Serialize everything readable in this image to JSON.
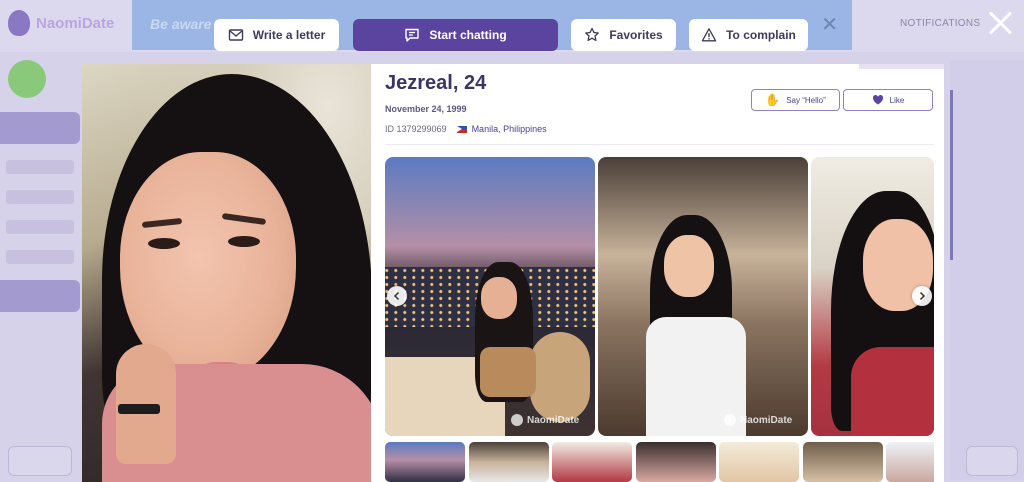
{
  "background": {
    "logo_text": "NaomiDate",
    "banner_text": "Be aware",
    "notifications_label": "NOTIFICATIONS"
  },
  "top_actions": {
    "write_letter": "Write a letter",
    "start_chatting": "Start chatting",
    "favorites": "Favorites",
    "complain": "To complain"
  },
  "profile": {
    "name": "Jezreal, 24",
    "birthdate": "November 24, 1999",
    "id": "ID 1379299069",
    "location": "Manila, Philippines",
    "say_hello": "Say “Hello”",
    "like": "Like"
  },
  "gallery": {
    "watermark": "NaomiDate",
    "photo_count": 3,
    "thumb_count": 7
  },
  "colors": {
    "accent": "#5a44a0",
    "text_dark": "#3d3466",
    "overlay": "#d6d2ea"
  }
}
